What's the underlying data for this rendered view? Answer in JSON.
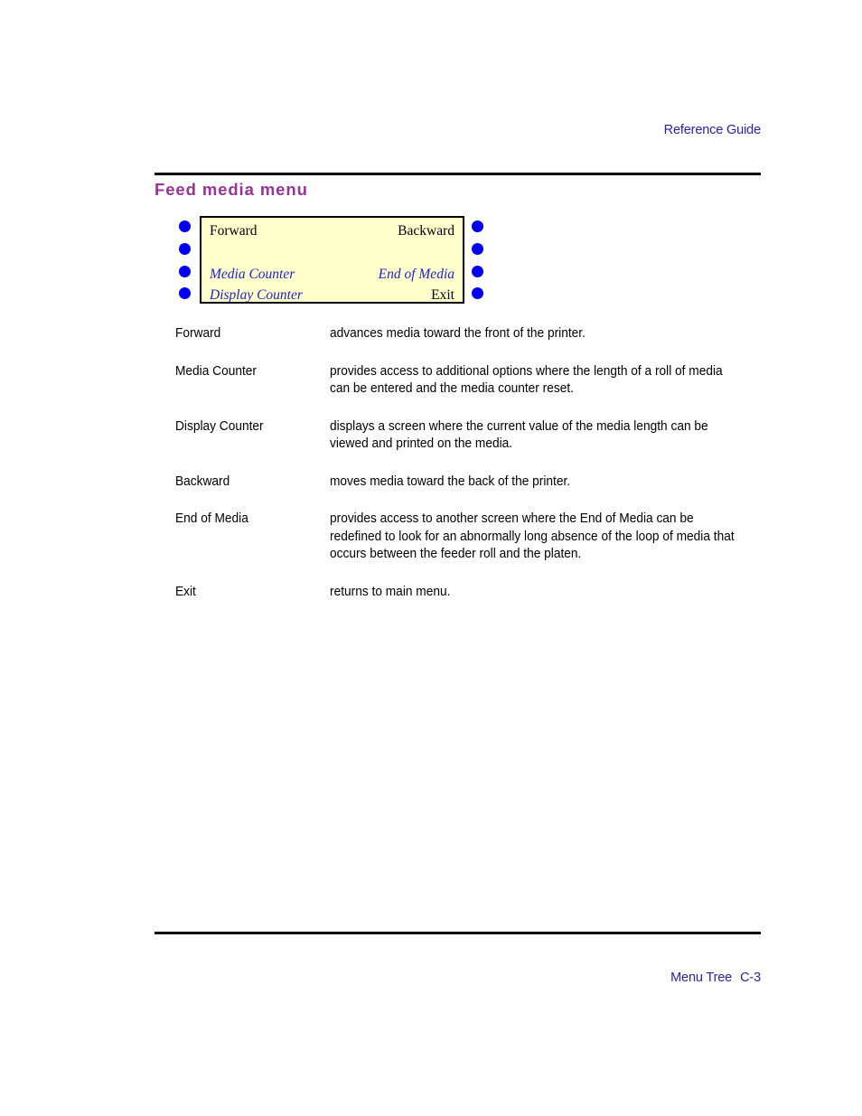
{
  "header": {
    "running_head": "Reference Guide"
  },
  "section": {
    "heading": "Feed media menu"
  },
  "menu_panel": {
    "rows": [
      {
        "left": "Forward",
        "left_style": "plain",
        "right": "Backward",
        "right_style": "plain"
      },
      {
        "left": "",
        "left_style": "plain",
        "right": "",
        "right_style": "plain"
      },
      {
        "left": "Media Counter",
        "left_style": "blue-italic",
        "right": "End of Media",
        "right_style": "blue-italic"
      },
      {
        "left": "Display Counter",
        "left_style": "blue-italic",
        "right": "Exit",
        "right_style": "plain"
      }
    ],
    "bullet_count_left": 4,
    "bullet_count_right": 4,
    "colors": {
      "panel_background": "#ffffcc",
      "panel_border": "#000000",
      "bullet": "#0000ee",
      "blue_text": "#2222cc",
      "plain_text": "#000000"
    }
  },
  "descriptions": [
    {
      "term": "Forward",
      "definition": "advances media toward the front of the printer."
    },
    {
      "term": "Media Counter",
      "definition": "provides access to additional options where the length of a roll of media can be entered and the media counter reset."
    },
    {
      "term": "Display Counter",
      "definition": "displays a screen where the current value of the media length can be viewed and printed on the media."
    },
    {
      "term": "Backward",
      "definition": "moves media toward the back of the printer."
    },
    {
      "term": "End of Media",
      "definition": "provides access to another screen where the End of Media can be redefined to look for an abnormally long absence of the loop of media that occurs between the feeder roll and the platen."
    },
    {
      "term": "Exit",
      "definition": "returns to main menu."
    }
  ],
  "footer": {
    "chapter_label": "Menu Tree",
    "page_number": "C-3"
  },
  "theme": {
    "heading_color": "#993399",
    "running_text_color": "#2a22a8",
    "rule_color": "#000000",
    "page_background": "#ffffff"
  }
}
